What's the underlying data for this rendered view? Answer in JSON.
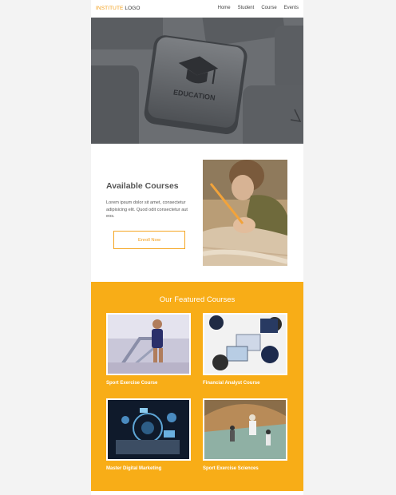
{
  "header": {
    "logo_brand": "INSTITUTE",
    "logo_rest": " LOGO",
    "nav": [
      "Home",
      "Student",
      "Course",
      "Events"
    ]
  },
  "hero": {
    "key_text": "EDUCATION"
  },
  "available": {
    "title": "Available Courses",
    "text": "Lorem ipsum dolor sit amet, consectetur adipisicing elit. Quod odit consectetur aut eos.",
    "button": "Enroll Now"
  },
  "featured": {
    "title": "Our Featured Courses",
    "cards": [
      {
        "label": "Sport Exercise Course"
      },
      {
        "label": "Financial Analyst Course"
      },
      {
        "label": "Master Digital Marketing"
      },
      {
        "label": "Sport Exercise Sciences"
      }
    ]
  },
  "colors": {
    "accent": "#f8ad17",
    "brand": "#f39c12"
  }
}
